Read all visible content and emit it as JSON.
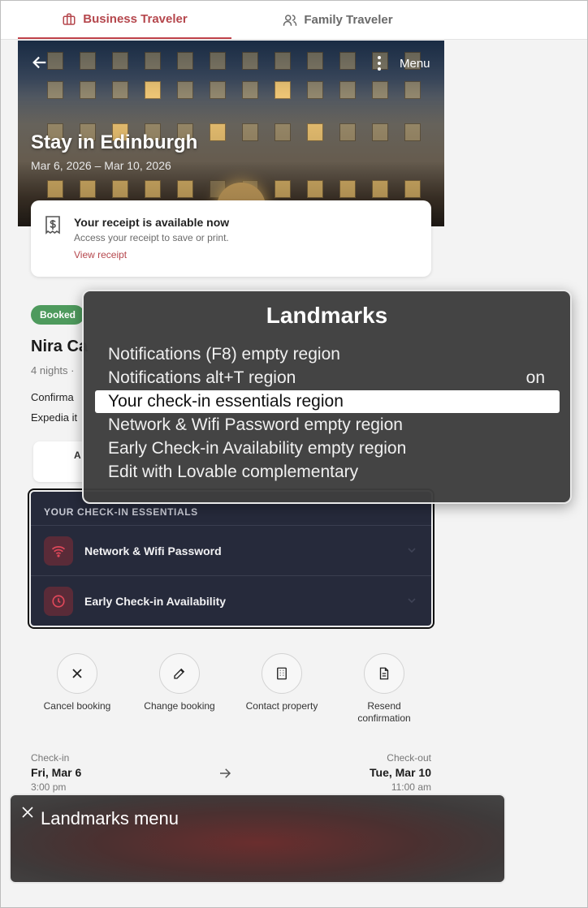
{
  "tabs": [
    {
      "label": "Business Traveler",
      "icon": "briefcase-icon",
      "active": true
    },
    {
      "label": "Family Traveler",
      "icon": "users-icon",
      "active": false
    }
  ],
  "hero": {
    "title": "Stay in Edinburgh",
    "dates": "Mar 6, 2026 – Mar 10, 2026",
    "menu_label": "Menu"
  },
  "receipt": {
    "title": "Your receipt is available now",
    "subtitle": "Access your receipt to save or print.",
    "link": "View receipt"
  },
  "booking": {
    "status": "Booked",
    "guest_name": "Nira Ca",
    "nights": "4 nights ·",
    "confirmation": "Confirma",
    "expedia": "Expedia it",
    "action_partial": "A"
  },
  "essentials": {
    "heading": "YOUR CHECK-IN ESSENTIALS",
    "items": [
      {
        "label": "Network & Wifi Password",
        "icon": "wifi-icon"
      },
      {
        "label": "Early Check-in Availability",
        "icon": "clock-icon"
      }
    ]
  },
  "quick_actions": [
    {
      "label": "Cancel booking",
      "icon": "x-icon"
    },
    {
      "label": "Change booking",
      "icon": "pencil-icon"
    },
    {
      "label": "Contact property",
      "icon": "building-icon"
    },
    {
      "label": "Resend\nconfirmation",
      "icon": "document-icon"
    }
  ],
  "stay": {
    "checkin_label": "Check-in",
    "checkin_date": "Fri, Mar 6",
    "checkin_time": "3:00 pm",
    "checkout_label": "Check-out",
    "checkout_date": "Tue, Mar 10",
    "checkout_time": "11:00 am"
  },
  "landmarks": {
    "title": "Landmarks",
    "items": [
      {
        "label": "Notifications (F8) empty region",
        "trailing": ""
      },
      {
        "label": "Notifications alt+T region",
        "trailing": "on"
      },
      {
        "label": "Your check-in essentials region",
        "trailing": "",
        "selected": true
      },
      {
        "label": "Network & Wifi Password empty region",
        "trailing": ""
      },
      {
        "label": "Early Check-in Availability empty region",
        "trailing": ""
      },
      {
        "label": "Edit with Lovable complementary",
        "trailing": ""
      }
    ]
  },
  "landmarks_menu": {
    "label": "Landmarks menu"
  },
  "colors": {
    "brand": "#b5474d",
    "booked_badge": "#4e9a5d",
    "essentials_bg": "#262a3b"
  }
}
